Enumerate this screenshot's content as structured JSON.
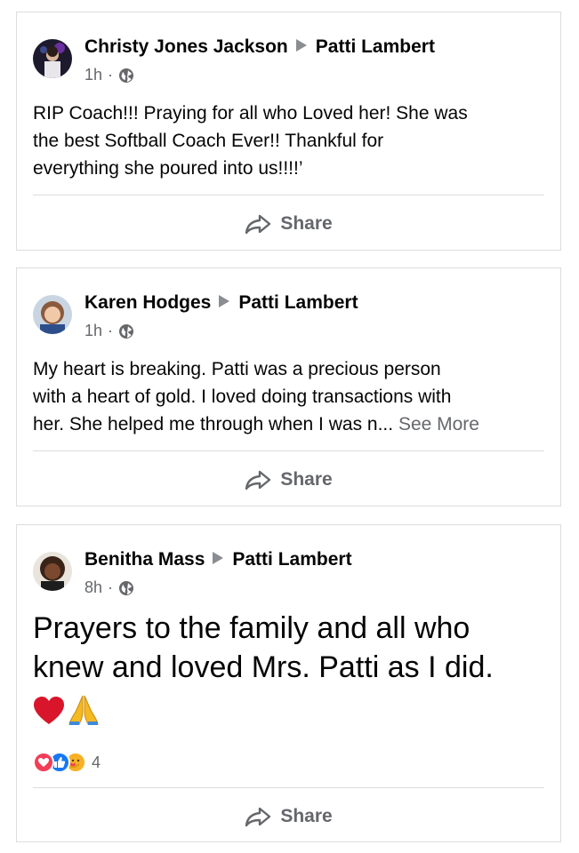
{
  "posts": [
    {
      "author": "Christy Jones Jackson",
      "target": "Patti Lambert",
      "time": "1h",
      "dot": "·",
      "text_lines": [
        "RIP Coach!!! Praying for all who Loved her! She was",
        "the best Softball Coach Ever!! Thankful for",
        "everything she poured into us!!!!’"
      ],
      "share_label": "Share",
      "avatar_icon": "avatar-photo"
    },
    {
      "author": "Karen Hodges",
      "target": "Patti Lambert",
      "time": "1h",
      "dot": "·",
      "text_lines": [
        "My heart is breaking. Patti was a precious person",
        "with a heart of gold. I loved doing transactions with",
        "her. She helped me through when I was n..."
      ],
      "see_more": "See More",
      "share_label": "Share",
      "avatar_icon": "avatar-photo"
    },
    {
      "author": "Benitha Mass",
      "target": "Patti Lambert",
      "time": "8h",
      "dot": "·",
      "text_lines": [
        "Prayers to the family and all who",
        "knew and loved Mrs. Patti as I did."
      ],
      "emojis": [
        "red-heart",
        "folded-hands"
      ],
      "reaction_count": "4",
      "reaction_icons": [
        "love-reaction-icon",
        "like-reaction-icon",
        "care-reaction-icon"
      ],
      "share_label": "Share",
      "avatar_icon": "avatar-photo"
    }
  ],
  "colors": {
    "border": "#dcdde0",
    "secondary_text": "#65676b",
    "primary_text": "#050505",
    "like_blue": "#1877f2",
    "love_red": "#f33e58",
    "care_yellow": "#f7b125"
  }
}
